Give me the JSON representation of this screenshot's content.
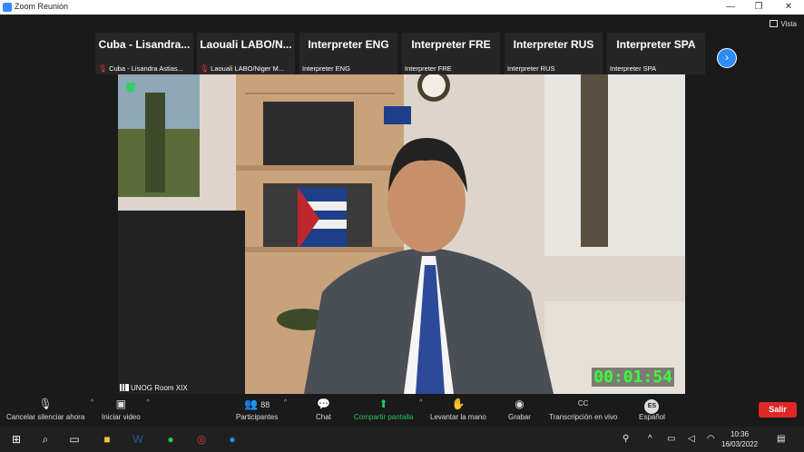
{
  "window": {
    "title": "Zoom Reunión",
    "minimize": "—",
    "restore": "❐",
    "close": "✕"
  },
  "view_button": {
    "label": "Vista"
  },
  "participants": [
    {
      "name": "Cuba - Lisandra...",
      "sub": "Cuba - Lisandra Astias...",
      "muted": true
    },
    {
      "name": "Laouali LABO/N...",
      "sub": "Laouali LABO/Niger M...",
      "muted": true
    },
    {
      "name": "Interpreter ENG",
      "sub": "Interpreter ENG",
      "muted": false
    },
    {
      "name": "Interpreter FRE",
      "sub": "Interpreter FRE",
      "muted": false
    },
    {
      "name": "Interpreter RUS",
      "sub": "Interpreter RUS",
      "muted": false
    },
    {
      "name": "Interpreter SPA",
      "sub": "Interpreter SPA",
      "muted": false
    }
  ],
  "main_video": {
    "label": "UNOG Room XIX",
    "timer": "00:01:54"
  },
  "toolbar": {
    "unmute": "Cancelar silenciar ahora",
    "start_video": "Iniciar video",
    "participants_label": "Participantes",
    "participants_count": "88",
    "chat": "Chat",
    "share": "Compartir pantalla",
    "raise_hand": "Levantar la mano",
    "record": "Grabar",
    "transcription": "Transcripción en vivo",
    "language_code": "ES",
    "language": "Español",
    "cc": "CC",
    "leave": "Salir"
  },
  "taskbar": {
    "time": "10:36",
    "date": "16/03/2022"
  },
  "colors": {
    "accent": "#2d8cff",
    "green": "#22c55e",
    "danger": "#e02828"
  }
}
